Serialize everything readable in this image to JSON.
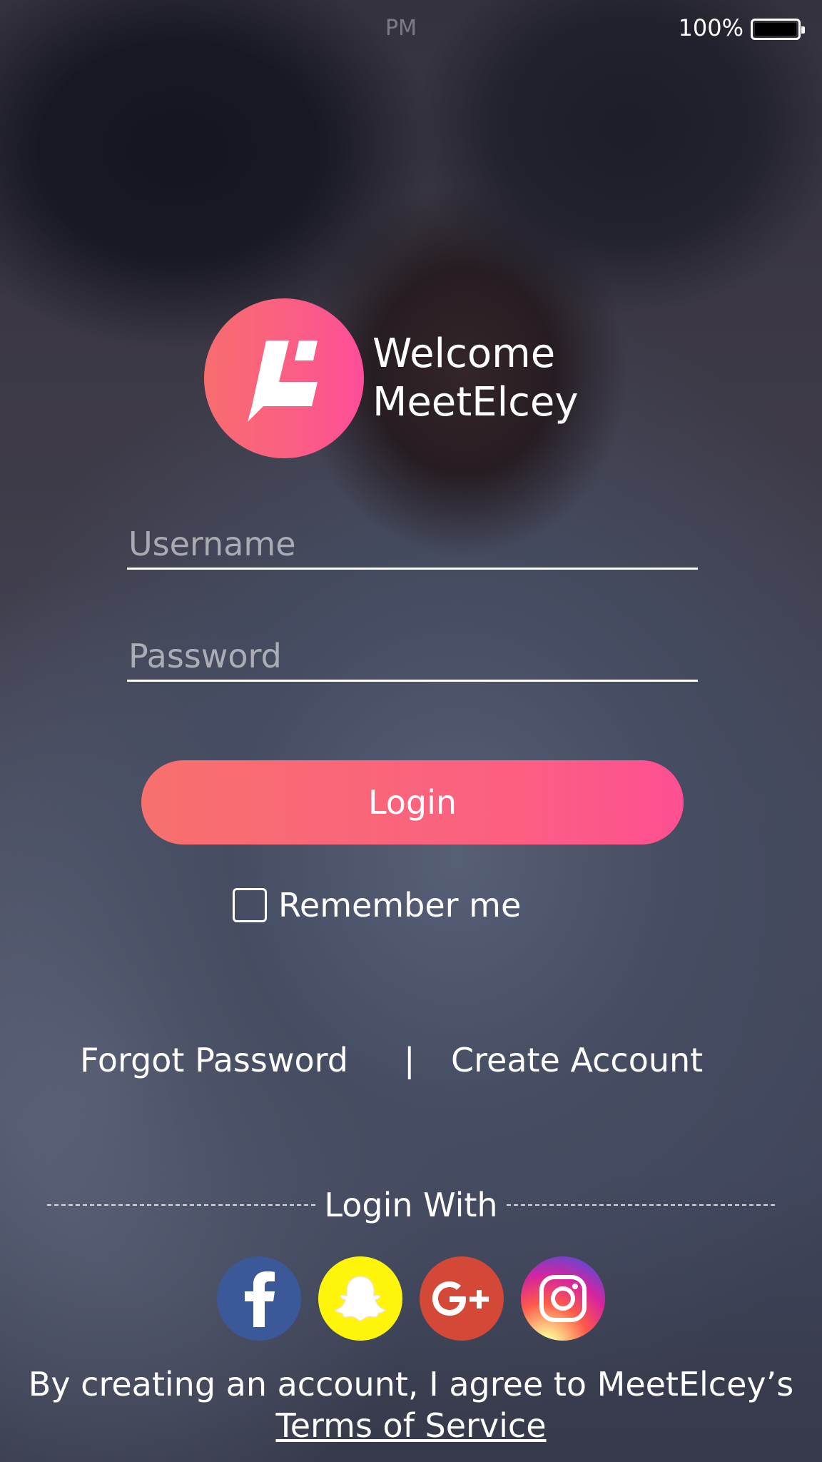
{
  "status_bar": {
    "carrier": "",
    "time": "PM",
    "battery_percent": "100%"
  },
  "brand": {
    "welcome_line1": "Welcome",
    "welcome_line2": "MeetElcey",
    "logo_icon": "meetelcey-logo-icon",
    "gradient_start": "#f76d6e",
    "gradient_end": "#ff4d99"
  },
  "form": {
    "username_placeholder": "Username",
    "username_value": "",
    "password_placeholder": "Password",
    "password_value": "",
    "login_label": "Login",
    "remember_label": "Remember me",
    "remember_checked": false
  },
  "links": {
    "forgot_password": "Forgot Password",
    "separator": "|",
    "create_account": "Create Account"
  },
  "social": {
    "heading": "Login With",
    "providers": [
      {
        "name": "facebook",
        "icon": "facebook-icon",
        "color": "#3b5998"
      },
      {
        "name": "snapchat",
        "icon": "snapchat-icon",
        "color": "#fff50a"
      },
      {
        "name": "google-plus",
        "icon": "google-plus-icon",
        "color": "#d34836"
      },
      {
        "name": "instagram",
        "icon": "instagram-icon",
        "color": "#d6249f"
      }
    ]
  },
  "footer": {
    "agreement_text": "By creating an account, I agree to MeetElcey’s",
    "terms_link": "Terms of Service"
  }
}
